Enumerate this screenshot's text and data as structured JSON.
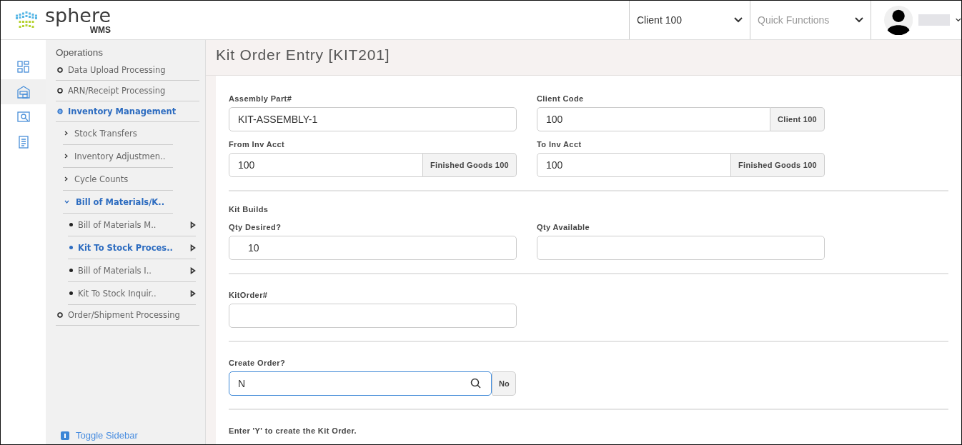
{
  "header": {
    "logo": {
      "name": "sphere",
      "sub": "WMS"
    },
    "client_select": {
      "value": "Client 100"
    },
    "quick_functions": {
      "placeholder": "Quick Functions"
    }
  },
  "rail": {
    "items": [
      {
        "kind": "dashboard",
        "selected": false
      },
      {
        "kind": "warehouse",
        "selected": true
      },
      {
        "kind": "scan",
        "selected": false
      },
      {
        "kind": "report",
        "selected": false
      }
    ]
  },
  "sidebar": {
    "title": "Operations",
    "items": [
      {
        "label": "Data Upload Processing",
        "selected": false
      },
      {
        "label": "ARN/Receipt Processing",
        "selected": false
      },
      {
        "label": "Inventory Management",
        "selected": true,
        "children": [
          {
            "label": "Stock Transfers",
            "selected": false,
            "expanded": false
          },
          {
            "label": "Inventory Adjustmen..",
            "selected": false,
            "expanded": false
          },
          {
            "label": "Cycle Counts",
            "selected": false,
            "expanded": false
          },
          {
            "label": "Bill of Materials/K..",
            "selected": true,
            "expanded": true,
            "children": [
              {
                "label": "Bill of Materials M..",
                "selected": false
              },
              {
                "label": "Kit To Stock Proces..",
                "selected": true
              },
              {
                "label": "Bill of Materials I..",
                "selected": false
              },
              {
                "label": "Kit To Stock Inquir..",
                "selected": false
              }
            ]
          }
        ]
      },
      {
        "label": "Order/Shipment Processing",
        "selected": false
      }
    ],
    "toggle": "Toggle Sidebar"
  },
  "page": {
    "title": "Kit Order Entry [KIT201]"
  },
  "form": {
    "sections": [
      {
        "rows": [
          [
            {
              "label": "Assembly Part#",
              "kind": "text",
              "value": "KIT-ASSEMBLY-1"
            },
            {
              "label": "Client Code",
              "kind": "addon",
              "value": "100",
              "addon": "Client 100"
            }
          ],
          [
            {
              "label": "From Inv Acct",
              "kind": "addon",
              "value": "100",
              "addon": "Finished Goods 100"
            },
            {
              "label": "To Inv Acct",
              "kind": "addon",
              "value": "100",
              "addon": "Finished Goods 100"
            }
          ]
        ]
      },
      {
        "heading": "Kit Builds",
        "rows": [
          [
            {
              "label": "Qty Desired?",
              "kind": "number",
              "value": "10"
            },
            {
              "label": "Qty Available",
              "kind": "text"
            }
          ]
        ]
      },
      {
        "rows": [
          [
            {
              "label": "KitOrder#",
              "kind": "text"
            }
          ]
        ]
      },
      {
        "rows": [
          [
            {
              "label": "Create Order?",
              "kind": "lookup",
              "value": "N",
              "addon": "No",
              "focused": true
            }
          ]
        ]
      }
    ],
    "hint": "Enter 'Y' to create the Kit Order."
  }
}
